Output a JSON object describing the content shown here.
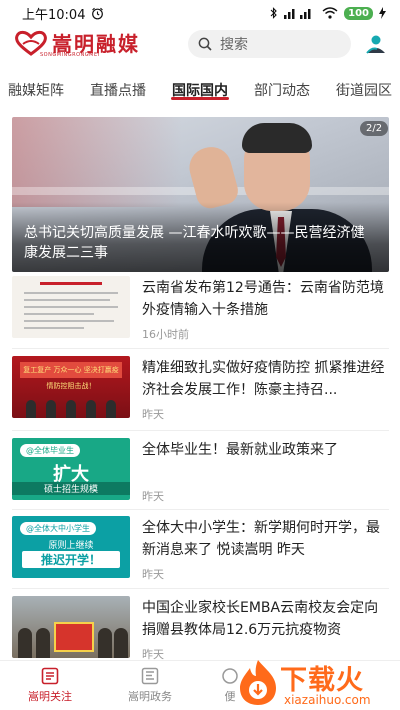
{
  "status_bar": {
    "time": "上午10:04",
    "battery": "100"
  },
  "header": {
    "logo_text": "嵩明融媒",
    "logo_sub": "SONGMINGRONGMEI",
    "search_placeholder": "搜索"
  },
  "tabs": [
    {
      "label": "融媒矩阵",
      "active": false
    },
    {
      "label": "直播点播",
      "active": false
    },
    {
      "label": "国际国内",
      "active": true
    },
    {
      "label": "部门动态",
      "active": false
    },
    {
      "label": "街道园区",
      "active": false
    }
  ],
  "hero": {
    "title": "总书记关切高质量发展 —江春水听欢歌——民营经济健康发展二三事",
    "page_indicator": "2/2"
  },
  "news": [
    {
      "title": "云南省发布第12号通告：云南省防范境外疫情输入十条措施",
      "time": "16小时前"
    },
    {
      "title": "精准细致扎实做好疫情防控 抓紧推进经济社会发展工作！陈豪主持召...",
      "time": "昨天"
    },
    {
      "title": "全体毕业生！最新就业政策来了",
      "time": "昨天"
    },
    {
      "title": "全体大中小学生：新学期何时开学，最新消息来了 悦读嵩明 昨天",
      "time": "昨天"
    },
    {
      "title": "中国企业家校长EMBA云南校友会定向捐赠县教体局12.6万元抗疫物资",
      "time": "昨天"
    }
  ],
  "thumbs": {
    "red_banner": "复工复产 万众一心 坚决打赢疫情防控阻击战！",
    "green_pill": "@全体毕业生",
    "green_big": "扩大",
    "green_small": "硕士招生规模",
    "teal_pill": "@全体大中小学生",
    "teal_sub": "原则上继续",
    "teal_big": "推迟开学！"
  },
  "bottom_nav": [
    {
      "label": "嵩明关注",
      "active": true
    },
    {
      "label": "嵩明政务",
      "active": false
    },
    {
      "label": "便",
      "active": false
    }
  ],
  "watermark": {
    "text": "下载火",
    "sub": "xiazaihuo.com"
  },
  "colors": {
    "brand": "#c8202b",
    "watermark": "#ff6a1a"
  }
}
